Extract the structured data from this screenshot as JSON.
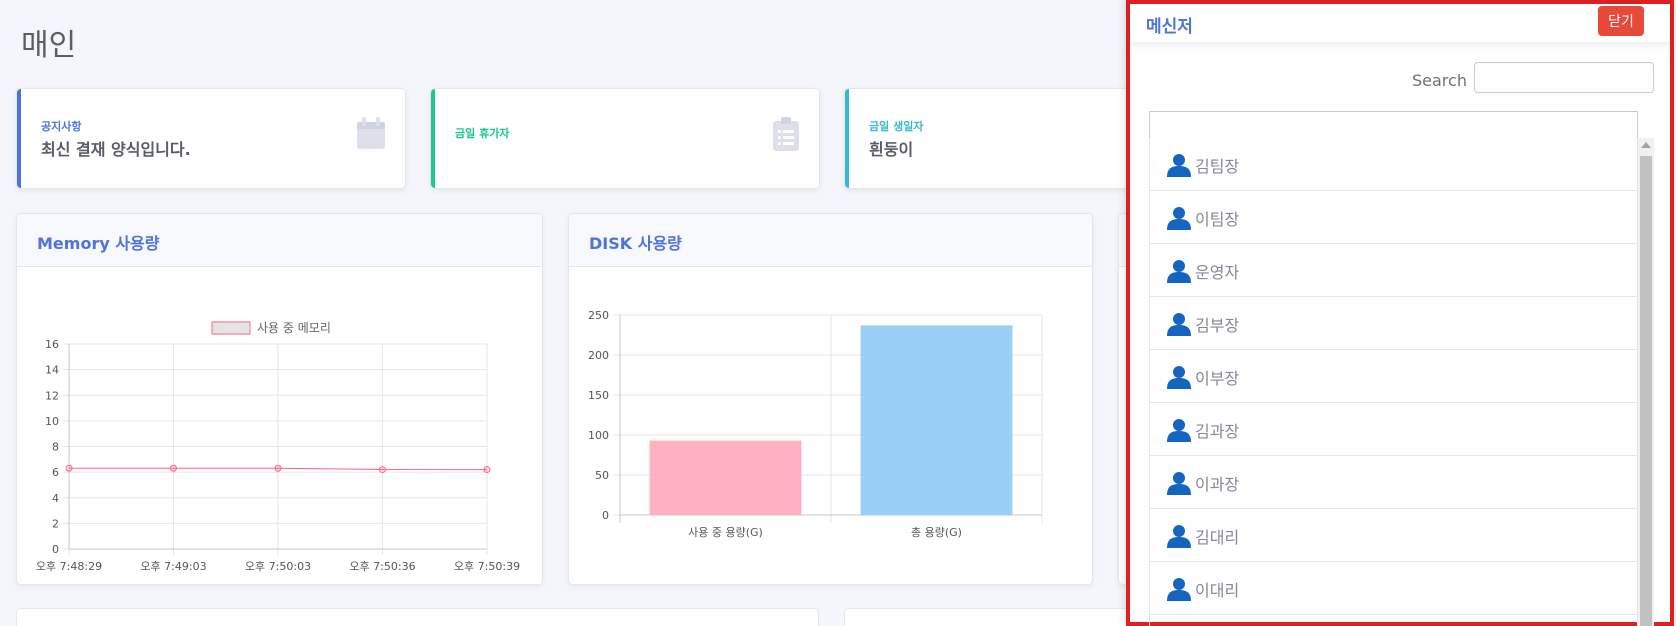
{
  "page": {
    "title": "매인"
  },
  "stat_cards": [
    {
      "label": "공지사항",
      "value": "최신 결재 양식입니다.",
      "icon": "calendar-icon"
    },
    {
      "label": "금일 휴가자",
      "value": "",
      "icon": "clipboard-list-icon"
    },
    {
      "label": "금일 생일자",
      "value": "흰둥이",
      "icon": ""
    }
  ],
  "memory_panel": {
    "title": "Memory 사용량"
  },
  "disk_panel": {
    "title": "DISK 사용량"
  },
  "chart_data": [
    {
      "type": "line",
      "title": "Memory 사용량",
      "legend": [
        "사용 중 메모리"
      ],
      "categories": [
        "오후 7:48:29",
        "오후 7:49:03",
        "오후 7:50:03",
        "오후 7:50:36",
        "오후 7:50:39"
      ],
      "series": [
        {
          "name": "사용 중 메모리",
          "values": [
            6.3,
            6.3,
            6.3,
            6.2,
            6.2
          ]
        }
      ],
      "ylim": [
        0,
        16
      ],
      "yticks": [
        0,
        2,
        4,
        6,
        8,
        10,
        12,
        14,
        16
      ],
      "grid": true,
      "legend_position": "top",
      "colors": {
        "line": "#ff6384",
        "fill": "#e5e5e5"
      }
    },
    {
      "type": "bar",
      "title": "DISK 사용량",
      "categories": [
        "사용 중 용량(G)",
        "총 용량(G)"
      ],
      "values": [
        93,
        237
      ],
      "ylim": [
        0,
        250
      ],
      "yticks": [
        0,
        50,
        100,
        150,
        200,
        250
      ],
      "grid": true,
      "colors": [
        "#ffb1c1",
        "#9ad0f5"
      ]
    }
  ],
  "messenger": {
    "title": "메신저",
    "close_label": "닫기",
    "search_label": "Search",
    "search_value": "",
    "users": [
      "김팀장",
      "이팀장",
      "운영자",
      "김부장",
      "이부장",
      "김과장",
      "이과장",
      "김대리",
      "이대리"
    ],
    "user_icon": "user-icon",
    "colors": {
      "accent": "#4e73df",
      "close": "#e74a3b",
      "border": "#e02020",
      "user_icon": "#1565c0"
    }
  }
}
